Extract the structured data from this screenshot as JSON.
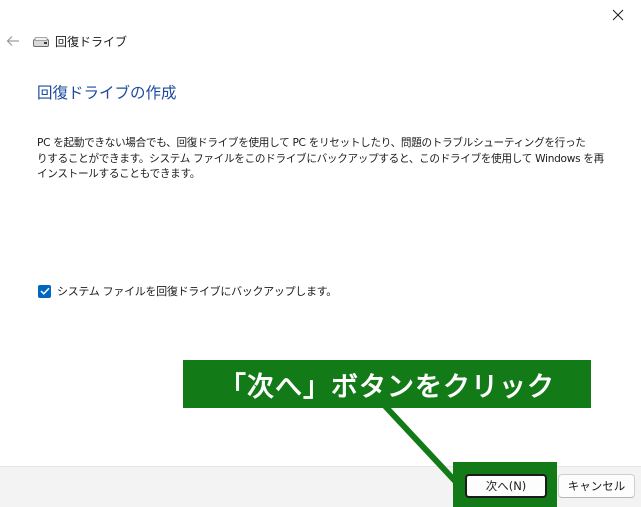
{
  "window": {
    "title": "回復ドライブ",
    "close_icon": "close-icon",
    "back_icon": "back-arrow-icon",
    "drive_icon": "drive-icon"
  },
  "main": {
    "heading": "回復ドライブの作成",
    "description_lines": [
      "PC を起動できない場合でも、回復ドライブを使用して PC をリセットしたり、問題のトラブルシューティングを行った",
      "りすることができます。システム ファイルをこのドライブにバックアップすると、このドライブを使用して Windows を再",
      "インストールすることもできます。"
    ],
    "checkbox": {
      "label": "システム ファイルを回復ドライブにバックアップします。",
      "checked": true
    }
  },
  "annotation": {
    "text": "「次へ」ボタンをクリック",
    "color": "#137a18"
  },
  "footer": {
    "next_label": "次へ(N)",
    "cancel_label": "キャンセル"
  },
  "colors": {
    "accent": "#0067c0",
    "heading": "#1d4b9c",
    "footer_bg": "#f3f3f3"
  }
}
